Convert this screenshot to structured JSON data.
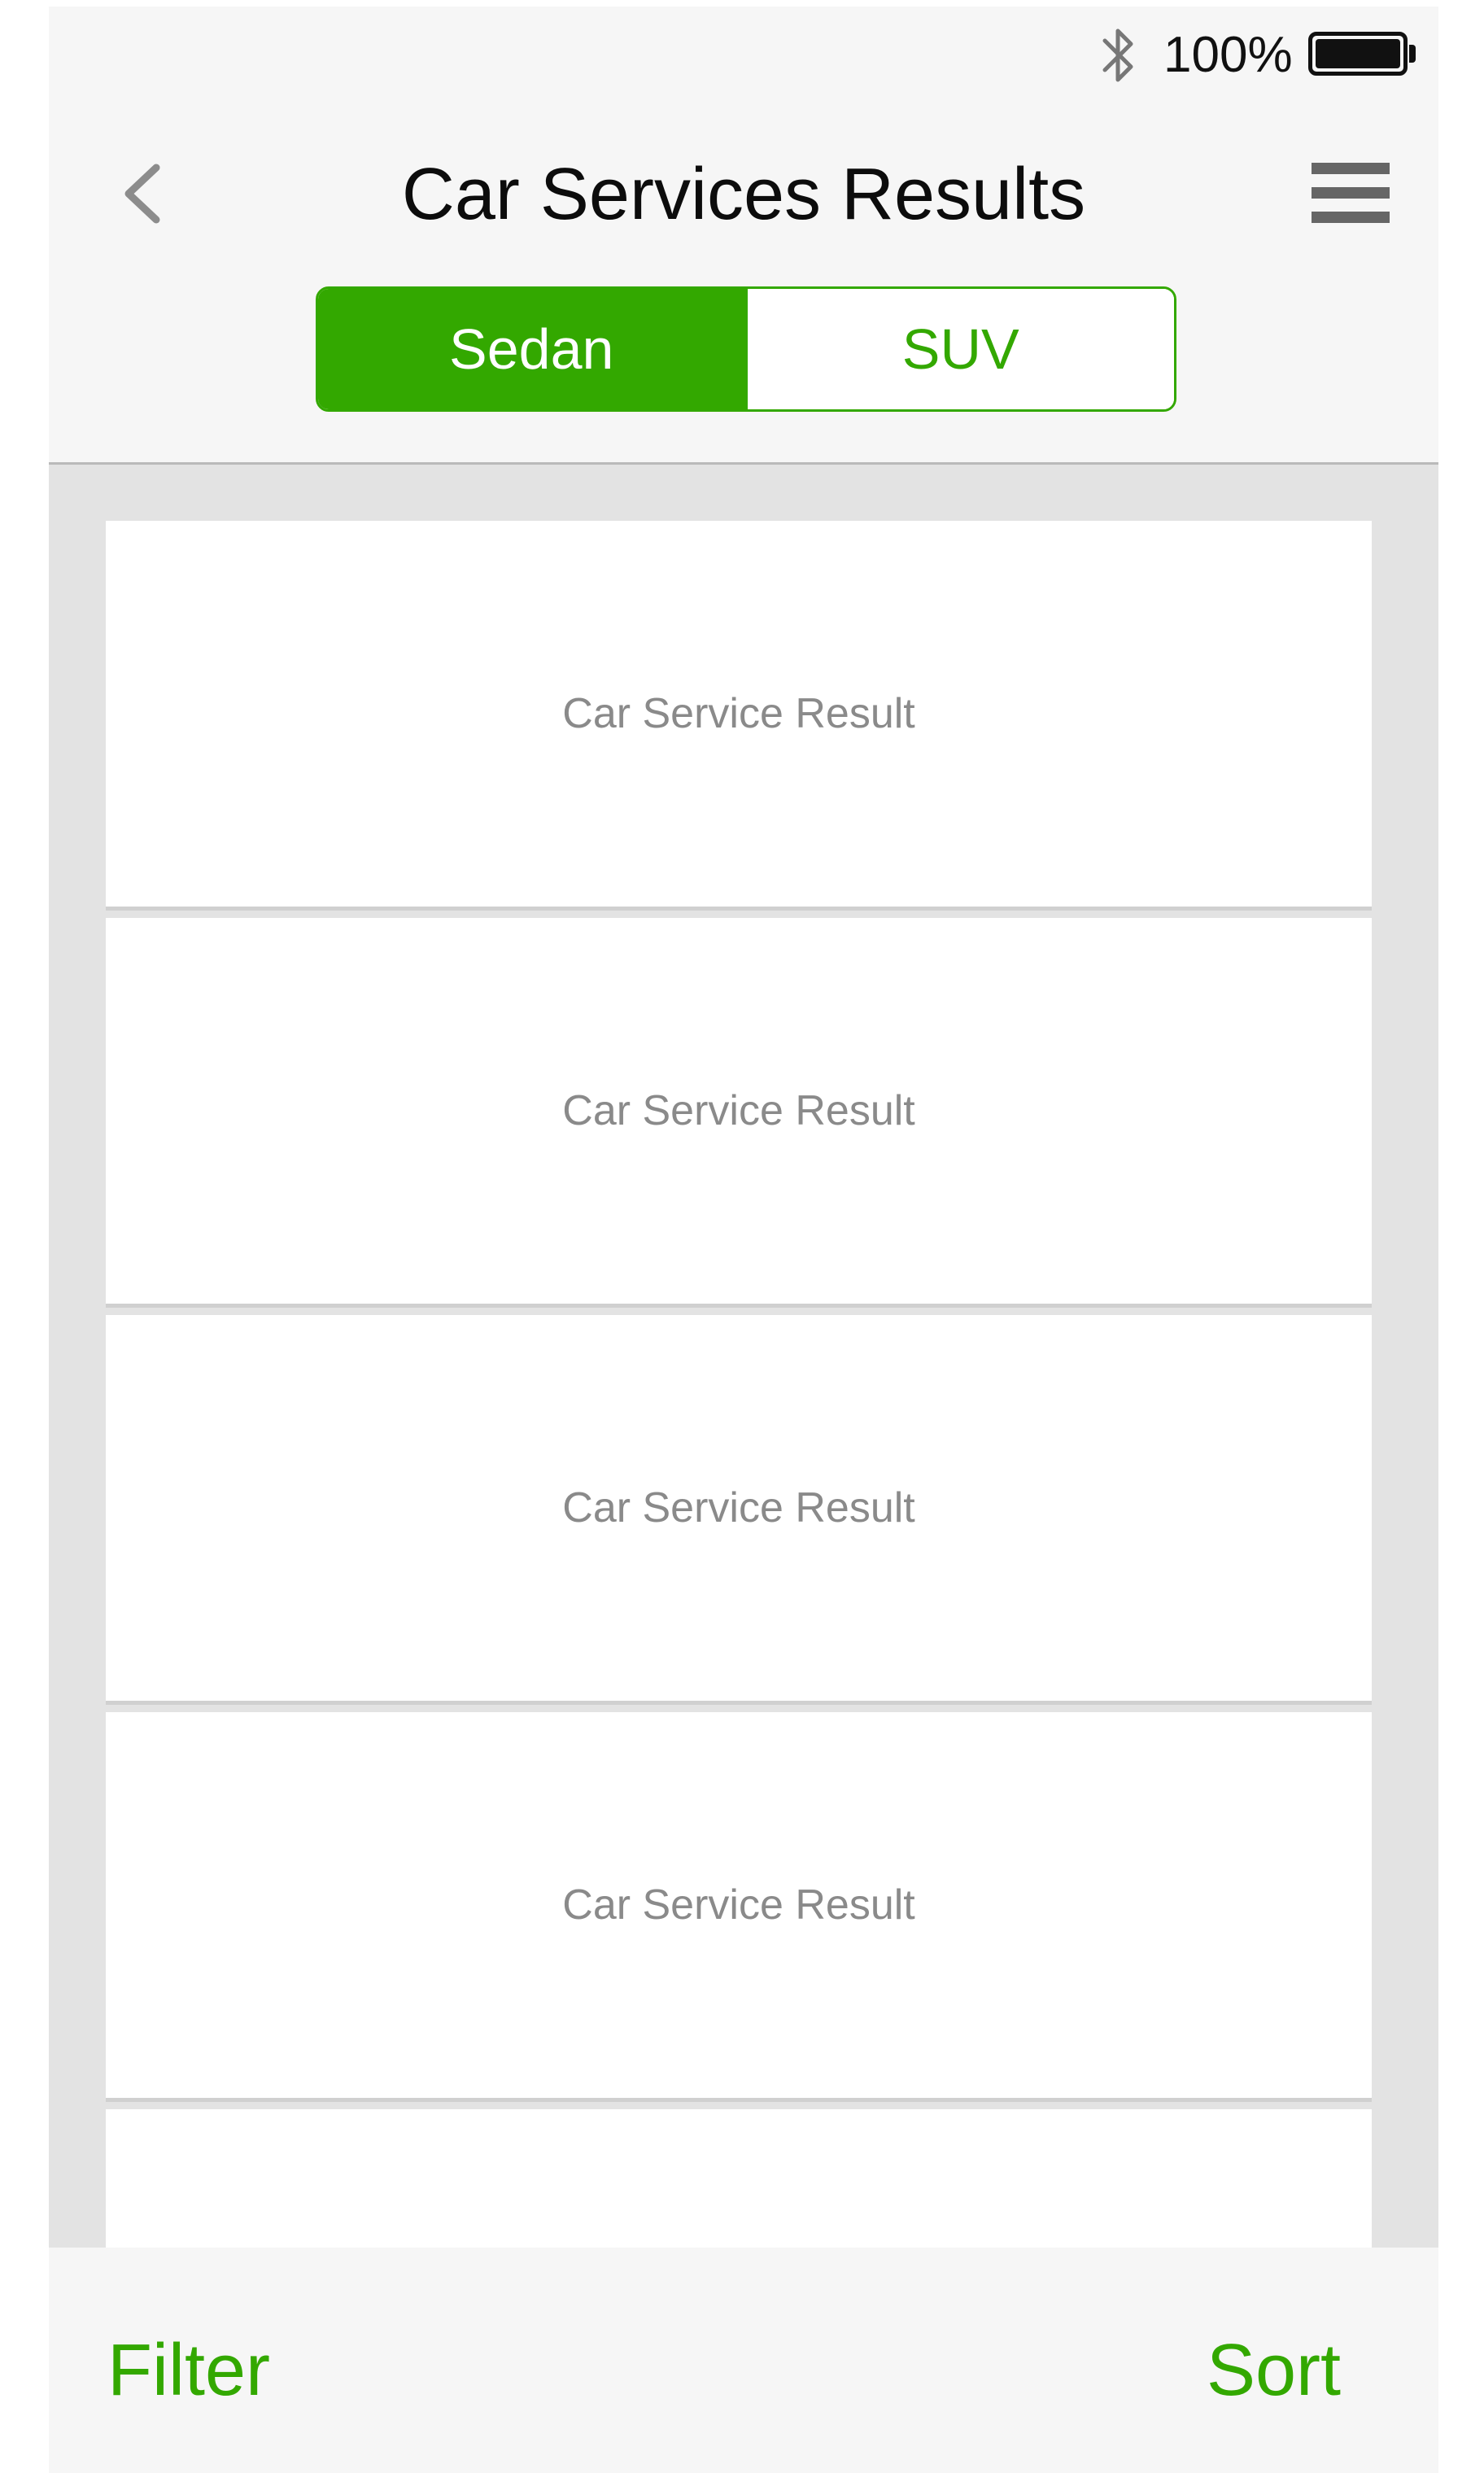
{
  "status_bar": {
    "bluetooth_icon": "bluetooth-icon",
    "battery_percent": "100%",
    "battery_icon": "battery-full-icon"
  },
  "header": {
    "back_icon": "chevron-left-icon",
    "title": "Car Services Results",
    "menu_icon": "hamburger-menu-icon"
  },
  "segments": {
    "selected": "Sedan",
    "items": [
      {
        "label": "Sedan"
      },
      {
        "label": "SUV"
      }
    ]
  },
  "results": [
    {
      "label": "Car Service Result"
    },
    {
      "label": "Car Service Result"
    },
    {
      "label": "Car Service Result"
    },
    {
      "label": "Car Service Result"
    },
    {
      "label": ""
    }
  ],
  "footer": {
    "filter_label": "Filter",
    "sort_label": "Sort"
  },
  "colors": {
    "accent": "#33a800",
    "background": "#e3e3e3",
    "bar": "#f6f6f6"
  }
}
